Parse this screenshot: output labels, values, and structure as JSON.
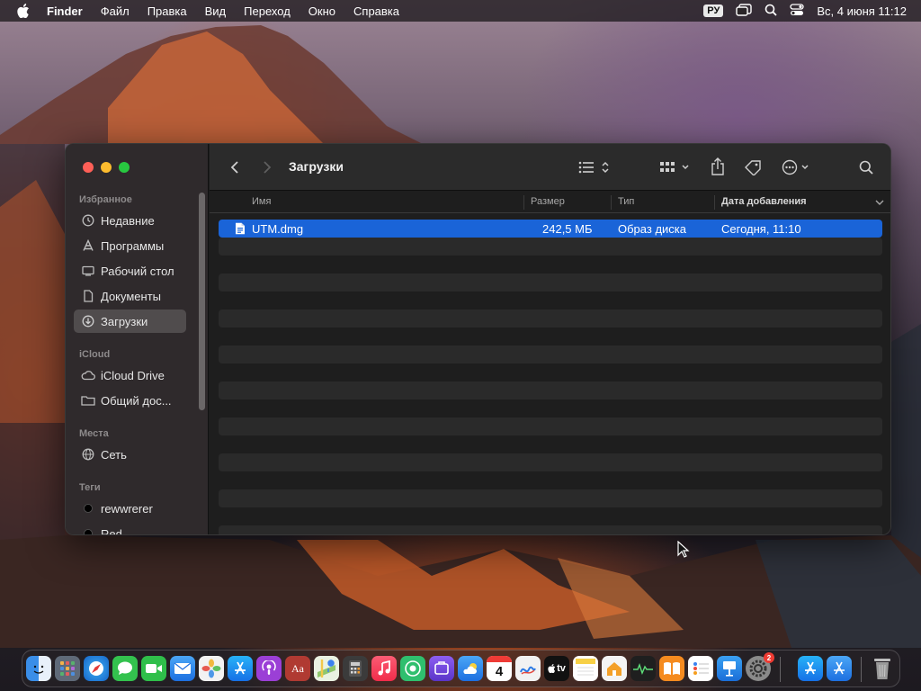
{
  "menubar": {
    "app_name": "Finder",
    "items": [
      "Файл",
      "Правка",
      "Вид",
      "Переход",
      "Окно",
      "Справка"
    ],
    "lang": "РУ",
    "clock": "Вс, 4 июня  11:12"
  },
  "window": {
    "title": "Загрузки",
    "sidebar": {
      "sections": {
        "favorites": "Избранное",
        "icloud": "iCloud",
        "locations": "Места",
        "tags": "Теги"
      },
      "favorites": [
        "Недавние",
        "Программы",
        "Рабочий стол",
        "Документы",
        "Загрузки"
      ],
      "icloud_items": [
        "iCloud Drive",
        "Общий дос..."
      ],
      "locations": [
        "Сеть"
      ],
      "tags": [
        "rewwrerer",
        "Red"
      ]
    },
    "columns": {
      "name": "Имя",
      "size": "Размер",
      "kind": "Тип",
      "date_added": "Дата добавления"
    },
    "files": [
      {
        "name": "UTM.dmg",
        "size": "242,5 МБ",
        "kind": "Образ диска",
        "date_added": "Сегодня, 11:10"
      }
    ]
  },
  "dock": {
    "calendar_day": "4",
    "tv_label": "tv",
    "settings_badge": "2",
    "dictionary_label": "Aa"
  },
  "colors": {
    "selection": "#1a64d8",
    "close": "#fe5f57",
    "minimize": "#febc2e",
    "zoom": "#28c840"
  }
}
